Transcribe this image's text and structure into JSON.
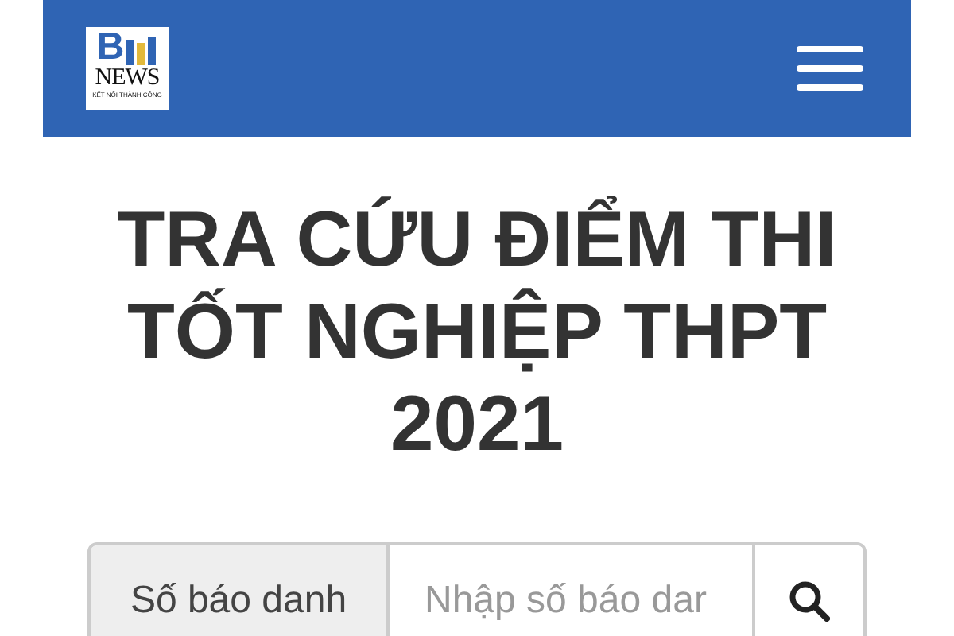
{
  "header": {
    "logo": {
      "letter": "B",
      "word": "NEWS",
      "tagline": "KẾT NỐI THÀNH CÔNG"
    }
  },
  "title_lines": [
    "TRA CỨU ĐIỂM THI",
    "TỐT NGHIỆP THPT",
    "2021"
  ],
  "search": {
    "label": "Số báo danh",
    "placeholder": "Nhập số báo dar"
  }
}
